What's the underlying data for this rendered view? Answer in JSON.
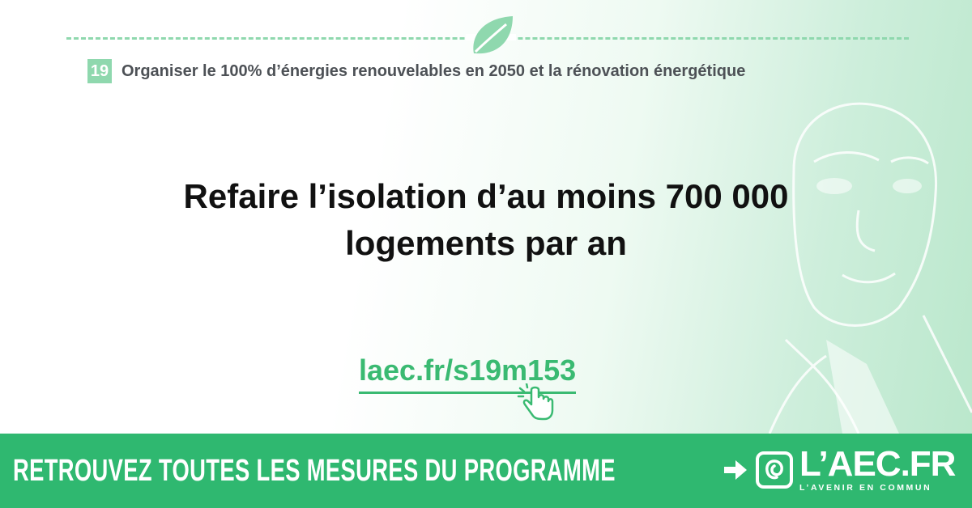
{
  "topic": {
    "number": "19",
    "title": "Organiser le 100% d’énergies renouvelables en 2050 et la rénovation énergétique"
  },
  "headline": {
    "line1": "Refaire l’isolation d’au moins 700 000",
    "line2": "logements par an"
  },
  "link": {
    "url": "laec.fr/s19m153"
  },
  "banner": {
    "text": "RETROUVEZ TOUTES LES MESURES DU PROGRAMME"
  },
  "logo": {
    "title": "L’AEC.FR",
    "subtitle": "L’AVENIR EN COMMUN"
  },
  "colors": {
    "green": "#2fb870",
    "light_green": "#8fd8ae",
    "link_green": "#3aba72"
  },
  "icons": [
    "leaf-icon",
    "click-hand-icon",
    "arrow-right-icon",
    "laec-logo-icon"
  ]
}
